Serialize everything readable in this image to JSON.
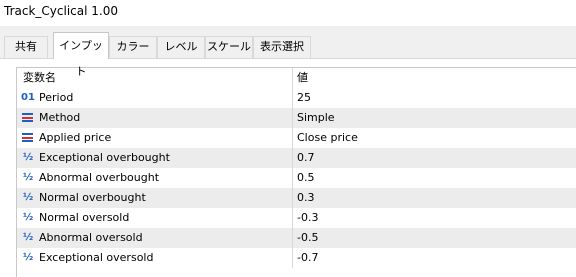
{
  "window": {
    "title": "Track_Cyclical 1.00"
  },
  "tabs": [
    {
      "label": "共有",
      "active": false
    },
    {
      "label": "インプット",
      "active": true
    },
    {
      "label": "カラー",
      "active": false
    },
    {
      "label": "レベル",
      "active": false
    },
    {
      "label": "スケール",
      "active": false
    },
    {
      "label": "表示選択",
      "active": false
    }
  ],
  "grid": {
    "headers": {
      "name": "変数名",
      "value": "値"
    },
    "rows": [
      {
        "icon": "01",
        "icon_name": "integer-icon",
        "name": "Period",
        "value": "25"
      },
      {
        "icon": "enum",
        "icon_name": "enum-icon",
        "name": "Method",
        "value": "Simple"
      },
      {
        "icon": "enum",
        "icon_name": "enum-icon",
        "name": "Applied price",
        "value": "Close price"
      },
      {
        "icon": "½",
        "icon_name": "double-icon",
        "name": "Exceptional overbought",
        "value": "0.7"
      },
      {
        "icon": "½",
        "icon_name": "double-icon",
        "name": "Abnormal overbought",
        "value": "0.5"
      },
      {
        "icon": "½",
        "icon_name": "double-icon",
        "name": "Normal overbought",
        "value": "0.3"
      },
      {
        "icon": "½",
        "icon_name": "double-icon",
        "name": "Normal oversold",
        "value": "-0.3"
      },
      {
        "icon": "½",
        "icon_name": "double-icon",
        "name": "Abnormal oversold",
        "value": "-0.5"
      },
      {
        "icon": "½",
        "icon_name": "double-icon",
        "name": "Exceptional oversold",
        "value": "-0.7"
      }
    ]
  },
  "colors": {
    "icon_blue": "#1f5fbf",
    "icon_red": "#d83030",
    "row_alt": "#ececec"
  }
}
